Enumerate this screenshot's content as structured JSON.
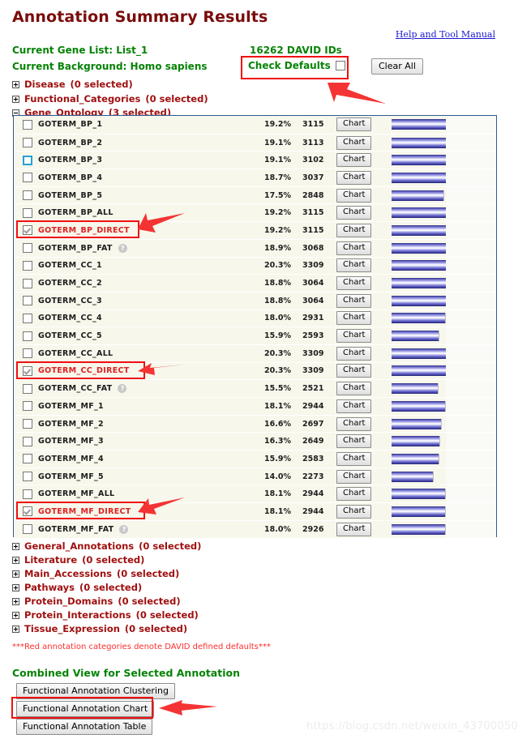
{
  "header": {
    "title": "Annotation Summary Results",
    "help_link": "Help and Tool Manual",
    "current_gene_list": "Current Gene List: List_1",
    "current_background": "Current Background: Homo sapiens",
    "david_ids": "16262 DAVID IDs",
    "check_defaults_label": "Check Defaults",
    "clear_all_label": "Clear All",
    "check_defaults_checked": false
  },
  "colors": {
    "title": "#7b0c0c",
    "green_text": "#068306",
    "category_red": "#a01010",
    "default_term_red": "#e02020",
    "link_blue": "#1a1ad0",
    "highlight_red": "#f01010",
    "table_border": "#2f5c8f",
    "row_bg": "#f7f7ec",
    "bar_blue": "#3a3a9e"
  },
  "categories_top": [
    {
      "name": "Disease",
      "count": "(0 selected)",
      "expanded": false
    },
    {
      "name": "Functional_Categories",
      "count": "(0 selected)",
      "expanded": false
    },
    {
      "name": "Gene_Ontology",
      "count": "(3 selected)",
      "expanded": true
    }
  ],
  "categories_bottom": [
    {
      "name": "General_Annotations",
      "count": "(0 selected)",
      "expanded": false
    },
    {
      "name": "Literature",
      "count": "(0 selected)",
      "expanded": false
    },
    {
      "name": "Main_Accessions",
      "count": "(0 selected)",
      "expanded": false
    },
    {
      "name": "Pathways",
      "count": "(0 selected)",
      "expanded": false
    },
    {
      "name": "Protein_Domains",
      "count": "(0 selected)",
      "expanded": false
    },
    {
      "name": "Protein_Interactions",
      "count": "(0 selected)",
      "expanded": false
    },
    {
      "name": "Tissue_Expression",
      "count": "(0 selected)",
      "expanded": false
    }
  ],
  "table": {
    "chart_button_label": "Chart",
    "help_icon_glyph": "?",
    "rows": [
      {
        "term": "GOTERM_BP_1",
        "percent": "19.2%",
        "count": "3115",
        "checked": false,
        "focused": false,
        "is_default": false,
        "has_help": false
      },
      {
        "term": "GOTERM_BP_2",
        "percent": "19.1%",
        "count": "3113",
        "checked": false,
        "focused": false,
        "is_default": false,
        "has_help": false
      },
      {
        "term": "GOTERM_BP_3",
        "percent": "19.1%",
        "count": "3102",
        "checked": false,
        "focused": true,
        "is_default": false,
        "has_help": false
      },
      {
        "term": "GOTERM_BP_4",
        "percent": "18.7%",
        "count": "3037",
        "checked": false,
        "focused": false,
        "is_default": false,
        "has_help": false
      },
      {
        "term": "GOTERM_BP_5",
        "percent": "17.5%",
        "count": "2848",
        "checked": false,
        "focused": false,
        "is_default": false,
        "has_help": false
      },
      {
        "term": "GOTERM_BP_ALL",
        "percent": "19.2%",
        "count": "3115",
        "checked": false,
        "focused": false,
        "is_default": false,
        "has_help": false
      },
      {
        "term": "GOTERM_BP_DIRECT",
        "percent": "19.2%",
        "count": "3115",
        "checked": true,
        "focused": false,
        "is_default": true,
        "has_help": false
      },
      {
        "term": "GOTERM_BP_FAT",
        "percent": "18.9%",
        "count": "3068",
        "checked": false,
        "focused": false,
        "is_default": false,
        "has_help": true
      },
      {
        "term": "GOTERM_CC_1",
        "percent": "20.3%",
        "count": "3309",
        "checked": false,
        "focused": false,
        "is_default": false,
        "has_help": false
      },
      {
        "term": "GOTERM_CC_2",
        "percent": "18.8%",
        "count": "3064",
        "checked": false,
        "focused": false,
        "is_default": false,
        "has_help": false
      },
      {
        "term": "GOTERM_CC_3",
        "percent": "18.8%",
        "count": "3064",
        "checked": false,
        "focused": false,
        "is_default": false,
        "has_help": false
      },
      {
        "term": "GOTERM_CC_4",
        "percent": "18.0%",
        "count": "2931",
        "checked": false,
        "focused": false,
        "is_default": false,
        "has_help": false
      },
      {
        "term": "GOTERM_CC_5",
        "percent": "15.9%",
        "count": "2593",
        "checked": false,
        "focused": false,
        "is_default": false,
        "has_help": false
      },
      {
        "term": "GOTERM_CC_ALL",
        "percent": "20.3%",
        "count": "3309",
        "checked": false,
        "focused": false,
        "is_default": false,
        "has_help": false
      },
      {
        "term": "GOTERM_CC_DIRECT",
        "percent": "20.3%",
        "count": "3309",
        "checked": true,
        "focused": false,
        "is_default": true,
        "has_help": false
      },
      {
        "term": "GOTERM_CC_FAT",
        "percent": "15.5%",
        "count": "2521",
        "checked": false,
        "focused": false,
        "is_default": false,
        "has_help": true
      },
      {
        "term": "GOTERM_MF_1",
        "percent": "18.1%",
        "count": "2944",
        "checked": false,
        "focused": false,
        "is_default": false,
        "has_help": false
      },
      {
        "term": "GOTERM_MF_2",
        "percent": "16.6%",
        "count": "2697",
        "checked": false,
        "focused": false,
        "is_default": false,
        "has_help": false
      },
      {
        "term": "GOTERM_MF_3",
        "percent": "16.3%",
        "count": "2649",
        "checked": false,
        "focused": false,
        "is_default": false,
        "has_help": false
      },
      {
        "term": "GOTERM_MF_4",
        "percent": "15.9%",
        "count": "2583",
        "checked": false,
        "focused": false,
        "is_default": false,
        "has_help": false
      },
      {
        "term": "GOTERM_MF_5",
        "percent": "14.0%",
        "count": "2273",
        "checked": false,
        "focused": false,
        "is_default": false,
        "has_help": false
      },
      {
        "term": "GOTERM_MF_ALL",
        "percent": "18.1%",
        "count": "2944",
        "checked": false,
        "focused": false,
        "is_default": false,
        "has_help": false
      },
      {
        "term": "GOTERM_MF_DIRECT",
        "percent": "18.1%",
        "count": "2944",
        "checked": true,
        "focused": false,
        "is_default": true,
        "has_help": false
      },
      {
        "term": "GOTERM_MF_FAT",
        "percent": "18.0%",
        "count": "2926",
        "checked": false,
        "focused": false,
        "is_default": false,
        "has_help": true
      }
    ]
  },
  "footer": {
    "red_note": "***Red annotation categories denote DAVID defined defaults***",
    "combined_title": "Combined View for Selected Annotation",
    "buttons": [
      "Functional Annotation Clustering",
      "Functional Annotation Chart",
      "Functional Annotation Table"
    ],
    "watermark": "https://blog.csdn.net/weixin_43700050"
  }
}
